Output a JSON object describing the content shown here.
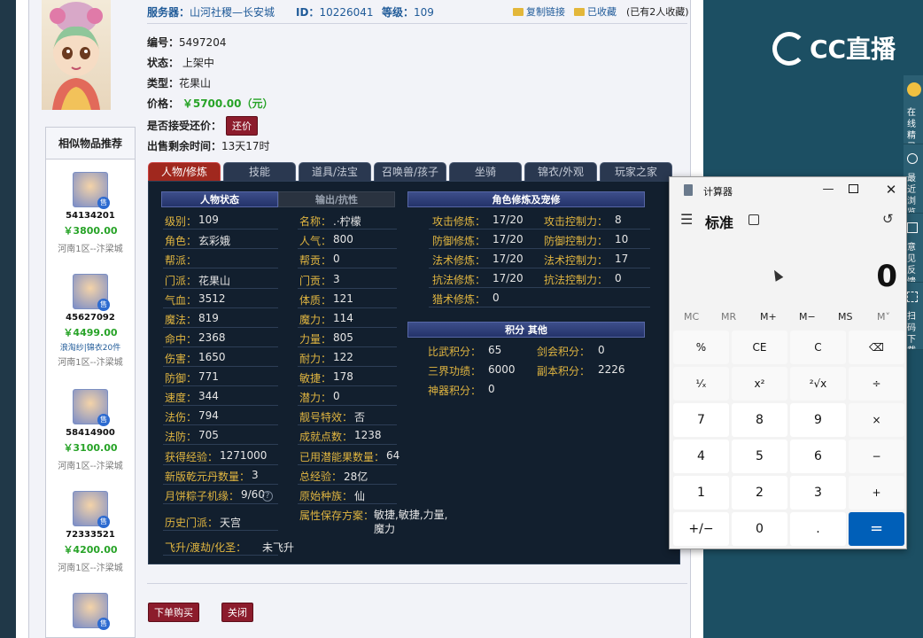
{
  "header": {
    "server_label": "服务器：",
    "server_value": "山河社稷—长安城",
    "id_label": "ID：",
    "id_value": "10226041",
    "level_label": "等级：",
    "level_value": "109",
    "copy_link": "复制链接",
    "favorited": "已收藏",
    "fav_count": "(已有2人收藏)"
  },
  "item": {
    "number_label": "编号：",
    "number_value": "5497204",
    "status_label": "状态：",
    "status_value": "上架中",
    "type_label": "类型：",
    "type_value": "花果山",
    "price_label": "价格：",
    "price_value": "￥5700.00（元）",
    "bargain_label": "是否接受还价：",
    "bargain_button": "还价",
    "remaining_label": "出售剩余时间：",
    "remaining_value": "13天17时"
  },
  "similar": {
    "title": "相似物品推荐",
    "items": [
      {
        "id": "54134201",
        "price": "￥3800.00",
        "extra": "",
        "server": "河南1区--汴梁城"
      },
      {
        "id": "45627092",
        "price": "￥4499.00",
        "extra": "浪淘纱|锦衣20件",
        "server": "河南1区--汴梁城"
      },
      {
        "id": "58414900",
        "price": "￥3100.00",
        "extra": "",
        "server": "河南1区--汴梁城"
      },
      {
        "id": "72333521",
        "price": "￥4200.00",
        "extra": "",
        "server": "河南1区--汴梁城"
      }
    ]
  },
  "tabs": [
    "人物/修炼",
    "技能",
    "道具/法宝",
    "召唤兽/孩子",
    "坐骑",
    "锦衣/外观",
    "玩家之家"
  ],
  "sections": {
    "status_head": "人物状态",
    "output_head": "输出/抗性",
    "cultivation_head": "角色修炼及宠修",
    "points_head": "积分 其他"
  },
  "stats_left": [
    {
      "k": "级别：",
      "v": "109"
    },
    {
      "k": "角色：",
      "v": "玄彩娥"
    },
    {
      "k": "帮派：",
      "v": ""
    },
    {
      "k": "门派：",
      "v": "花果山"
    },
    {
      "k": "气血：",
      "v": "3512"
    },
    {
      "k": "魔法：",
      "v": "819"
    },
    {
      "k": "命中：",
      "v": "2368"
    },
    {
      "k": "伤害：",
      "v": "1650"
    },
    {
      "k": "防御：",
      "v": "771"
    },
    {
      "k": "速度：",
      "v": "344"
    },
    {
      "k": "法伤：",
      "v": "794"
    },
    {
      "k": "法防：",
      "v": "705"
    },
    {
      "k": "获得经验：",
      "v": "1271000"
    },
    {
      "k": "新版乾元丹数量：",
      "v": "3"
    },
    {
      "k": "月饼粽子机缘：",
      "v": "9/60"
    },
    {
      "k": "历史门派：",
      "v": "天宫"
    },
    {
      "k": "飞升/渡劫/化圣：",
      "v": "未飞升"
    }
  ],
  "stats_mid": [
    {
      "k": "名称：",
      "v": ".·柠檬"
    },
    {
      "k": "人气：",
      "v": "800"
    },
    {
      "k": "帮贡：",
      "v": "0"
    },
    {
      "k": "门贡：",
      "v": "3"
    },
    {
      "k": "体质：",
      "v": "121"
    },
    {
      "k": "魔力：",
      "v": "114"
    },
    {
      "k": "力量：",
      "v": "805"
    },
    {
      "k": "耐力：",
      "v": "122"
    },
    {
      "k": "敏捷：",
      "v": "178"
    },
    {
      "k": "潜力：",
      "v": "0"
    },
    {
      "k": "靓号特效：",
      "v": "否"
    },
    {
      "k": "成就点数：",
      "v": "1238"
    },
    {
      "k": "已用潜能果数量：",
      "v": "64"
    },
    {
      "k": "总经验：",
      "v": "28亿"
    },
    {
      "k": "原始种族：",
      "v": "仙"
    },
    {
      "k": "属性保存方案：",
      "v": "敏捷,敏捷,力量,魔力"
    }
  ],
  "cultivation": [
    {
      "k1": "攻击修炼：",
      "v1": "17/20",
      "k2": "攻击控制力：",
      "v2": "8"
    },
    {
      "k1": "防御修炼：",
      "v1": "17/20",
      "k2": "防御控制力：",
      "v2": "10"
    },
    {
      "k1": "法术修炼：",
      "v1": "17/20",
      "k2": "法术控制力：",
      "v2": "17"
    },
    {
      "k1": "抗法修炼：",
      "v1": "17/20",
      "k2": "抗法控制力：",
      "v2": "0"
    },
    {
      "k1": "猎术修炼：",
      "v1": "0",
      "k2": "",
      "v2": ""
    }
  ],
  "points": [
    {
      "k1": "比武积分：",
      "v1": "65",
      "k2": "剑会积分：",
      "v2": "0"
    },
    {
      "k1": "三界功绩：",
      "v1": "6000",
      "k2": "副本积分：",
      "v2": "2226"
    },
    {
      "k1": "神器积分：",
      "v1": "0",
      "k2": "",
      "v2": ""
    }
  ],
  "bottom": {
    "buy": "下单购买",
    "close": "关闭"
  },
  "cc": {
    "logo": "CC直播"
  },
  "rail": [
    "在线精灵",
    "最近浏览",
    "意见反馈",
    "扫码下载"
  ],
  "calc": {
    "title": "计算器",
    "mode": "标准",
    "display": "0",
    "memory": [
      "MC",
      "MR",
      "M+",
      "M−",
      "MS",
      "M˅"
    ],
    "keys": [
      [
        "%",
        "CE",
        "C",
        "⌫"
      ],
      [
        "¹⁄ₓ",
        "x²",
        "²√x",
        "÷"
      ],
      [
        "7",
        "8",
        "9",
        "×"
      ],
      [
        "4",
        "5",
        "6",
        "−"
      ],
      [
        "1",
        "2",
        "3",
        "+"
      ],
      [
        "+/−",
        "0",
        ".",
        "="
      ]
    ]
  },
  "colors": {
    "accent_red": "#8c1c2c",
    "price_green": "#27a327",
    "calc_equals": "#005fb8",
    "link_blue": "#1f5a98"
  }
}
